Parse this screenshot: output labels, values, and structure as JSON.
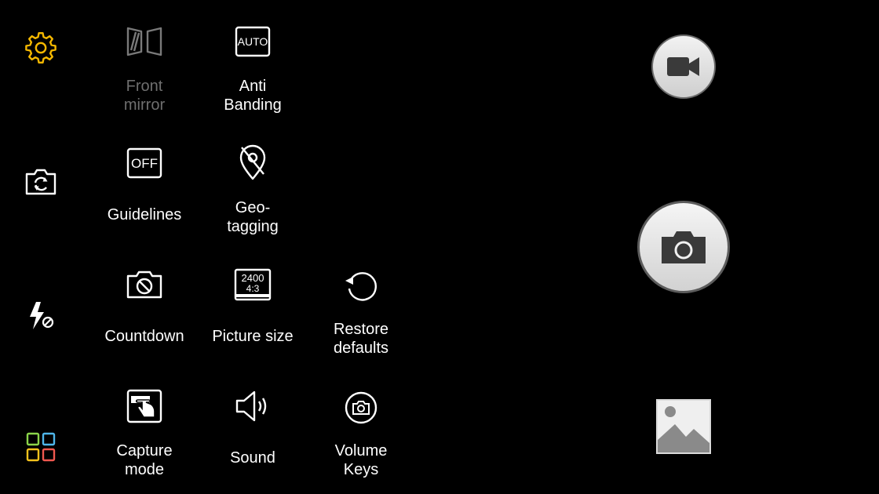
{
  "left_rail": {
    "settings_icon": "gear-icon",
    "switch_camera_icon": "camera-switch-icon",
    "flash_icon": "flash-off-icon",
    "modes_icon": "grid-modes-icon"
  },
  "settings": [
    {
      "id": "front-mirror",
      "label": "Front\nmirror",
      "icon": "front-mirror-icon",
      "enabled": false
    },
    {
      "id": "anti-banding",
      "label": "Anti\nBanding",
      "icon": "auto-icon",
      "icon_text": "AUTO",
      "enabled": true
    },
    {
      "id": "guidelines",
      "label": "Guidelines",
      "icon": "off-icon",
      "icon_text": "OFF",
      "enabled": true
    },
    {
      "id": "geo-tagging",
      "label": "Geo-\ntagging",
      "icon": "location-off-icon",
      "enabled": true
    },
    {
      "id": "countdown",
      "label": "Countdown",
      "icon": "timer-off-icon",
      "enabled": true
    },
    {
      "id": "picture-size",
      "label": "Picture size",
      "icon": "picture-size-icon",
      "icon_text_top": "2400",
      "icon_text_bottom": "4:3",
      "enabled": true
    },
    {
      "id": "restore-defaults",
      "label": "Restore\ndefaults",
      "icon": "restore-icon",
      "enabled": true
    },
    {
      "id": "capture-mode",
      "label": "Capture\nmode",
      "icon": "touch-capture-icon",
      "enabled": true
    },
    {
      "id": "sound",
      "label": "Sound",
      "icon": "speaker-icon",
      "enabled": true
    },
    {
      "id": "volume-keys",
      "label": "Volume\nKeys",
      "icon": "camera-circle-icon",
      "enabled": true
    }
  ],
  "right_rail": {
    "video_icon": "video-camera-icon",
    "shutter_icon": "camera-icon",
    "gallery_icon": "gallery-thumbnail-icon"
  },
  "colors": {
    "background": "#000000",
    "accent": "#f5b800",
    "disabled_text": "#6f6f6f",
    "button_icon": "#3a3a3a"
  }
}
